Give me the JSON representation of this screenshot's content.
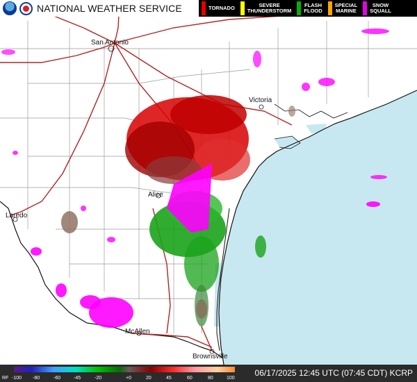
{
  "header": {
    "agency_title": "NATIONAL WEATHER SERVICE",
    "logos": [
      "noaa-logo",
      "nws-logo"
    ]
  },
  "warning_legend": [
    {
      "label": "TORNADO",
      "color": "#e60000"
    },
    {
      "label": "SEVERE\nTHUNDERSTORM",
      "color": "#ffff00"
    },
    {
      "label": "FLASH\nFLOOD",
      "color": "#00b300"
    },
    {
      "label": "SPECIAL\nMARINE",
      "color": "#ffa500"
    },
    {
      "label": "SNOW\nSQUALL",
      "color": "#e600e6"
    }
  ],
  "cities": {
    "san_antonio": "San Antonio",
    "victoria": "Victoria",
    "alice": "Alice",
    "laredo": "Laredo",
    "mcallen": "McAllen",
    "brownsville": "Brownsville"
  },
  "footer": {
    "timestamp": "06/17/2025 12:45 UTC (07:45 CDT) KCRP",
    "scale_label": "RF",
    "scale_ticks": [
      "-100",
      "-80",
      "-60",
      "-45",
      "-20",
      "+0",
      "20",
      "45",
      "60",
      "80",
      "100"
    ]
  },
  "colors": {
    "water": "#c7e8f0",
    "land": "#ffffff",
    "highway": "#b22222",
    "county_line": "#9a9a9a",
    "inbound_velocity": "#d80000",
    "outbound_velocity": "#1aa31a",
    "range_folded": "#ff00ff"
  }
}
